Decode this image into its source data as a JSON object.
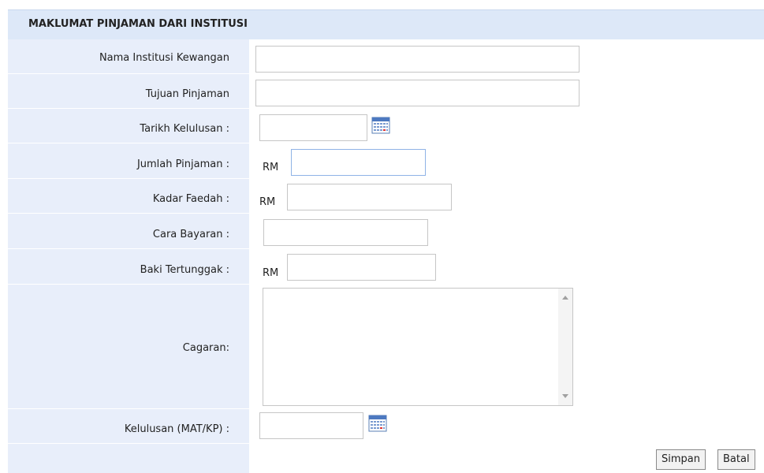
{
  "section": {
    "title": "MAKLUMAT PINJAMAN DARI INSTITUSI"
  },
  "fields": {
    "nama_institusi": {
      "label": "Nama Institusi Kewangan",
      "value": ""
    },
    "tujuan": {
      "label": "Tujuan Pinjaman",
      "value": ""
    },
    "tarikh_kelulusan": {
      "label": "Tarikh Kelulusan :",
      "value": ""
    },
    "jumlah": {
      "label": "Jumlah Pinjaman :",
      "prefix": "RM",
      "value": ""
    },
    "kadar_faedah": {
      "label": "Kadar Faedah :",
      "prefix": "RM",
      "value": ""
    },
    "cara_bayaran": {
      "label": "Cara Bayaran :",
      "value": ""
    },
    "baki": {
      "label": "Baki Tertunggak :",
      "prefix": "RM",
      "value": ""
    },
    "cagaran": {
      "label": "Cagaran:",
      "value": ""
    },
    "kelulusan_mat": {
      "label": "Kelulusan (MAT/KP) :",
      "value": ""
    }
  },
  "buttons": {
    "save": "Simpan",
    "cancel": "Batal"
  },
  "icons": {
    "calendar": "calendar-icon"
  },
  "colors": {
    "header_bg": "#dde8f8",
    "label_bg": "#e8eefa",
    "focus_border": "#8fb3e6"
  }
}
